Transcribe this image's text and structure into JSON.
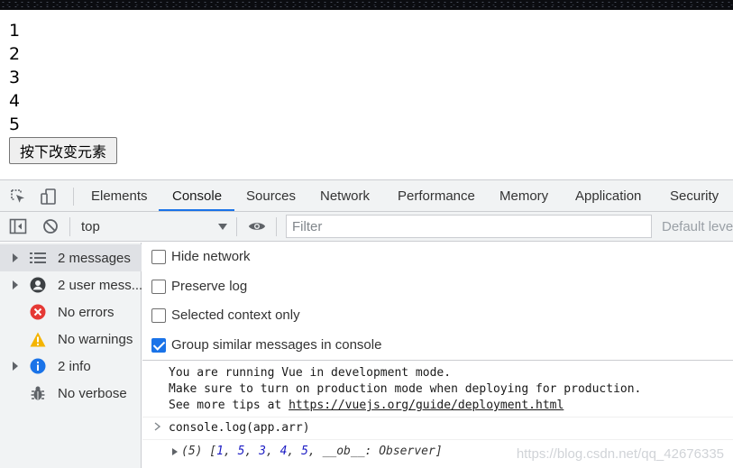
{
  "page": {
    "numbers": [
      "1",
      "2",
      "3",
      "4",
      "5"
    ],
    "change_button_label": "按下改变元素"
  },
  "devtools": {
    "tabs": [
      "Elements",
      "Console",
      "Sources",
      "Network",
      "Performance",
      "Memory",
      "Application",
      "Security"
    ],
    "active_tab": "Console",
    "toolbar": {
      "context": "top",
      "filter_placeholder": "Filter",
      "default_levels": "Default leve"
    },
    "sidebar": [
      {
        "label": "2 messages",
        "icon": "list-icon",
        "expandable": true,
        "selected": true
      },
      {
        "label": "2 user mess...",
        "icon": "user-icon",
        "expandable": true,
        "selected": false
      },
      {
        "label": "No errors",
        "icon": "error-icon",
        "expandable": false,
        "selected": false
      },
      {
        "label": "No warnings",
        "icon": "warning-icon",
        "expandable": false,
        "selected": false
      },
      {
        "label": "2 info",
        "icon": "info-icon",
        "expandable": true,
        "selected": false
      },
      {
        "label": "No verbose",
        "icon": "bug-icon",
        "expandable": false,
        "selected": false
      }
    ],
    "settings": [
      {
        "label": "Hide network",
        "checked": false
      },
      {
        "label": "Preserve log",
        "checked": false
      },
      {
        "label": "Selected context only",
        "checked": false
      },
      {
        "label": "Group similar messages in console",
        "checked": true
      }
    ],
    "console": {
      "vue_message_line1": "You are running Vue in development mode.",
      "vue_message_line2": "Make sure to turn on production mode when deploying for production.",
      "vue_message_line3_prefix": "See more tips at ",
      "vue_message_link": "https://vuejs.org/guide/deployment.html",
      "command": "console.log(app.arr)",
      "result": {
        "length_label": "(5)",
        "values": [
          "1",
          "5",
          "3",
          "4",
          "5"
        ],
        "observer_key": "__ob__",
        "observer_value": "Observer"
      }
    },
    "watermark": "https://blog.csdn.net/qq_42676335"
  },
  "colors": {
    "accent": "#1a73e8",
    "panel_bg": "#f1f3f4",
    "error": "#e53935",
    "warning": "#f4b400",
    "info": "#1a73e8"
  }
}
